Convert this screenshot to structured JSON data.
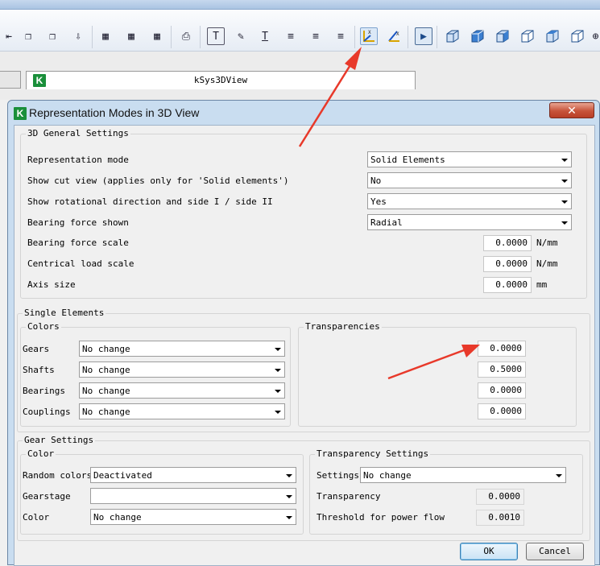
{
  "app": {
    "document_tab_title": "kSys3DView",
    "logo_letter": "K"
  },
  "toolbar": {
    "icons": [
      "merge-icon",
      "copy-icon",
      "paste-icon",
      "table-text-icon",
      "table-add-icon",
      "table-add-2-icon",
      "print-icon",
      "text-box-icon",
      "paint-icon",
      "text-underline-icon",
      "align-left-icon",
      "align-center-icon",
      "align-right-icon",
      "axis-zxy-icon",
      "axis-zxy-2-icon",
      "play-icon",
      "cube-icon",
      "cube-view-icon"
    ],
    "labels": {
      "text_icon": "T",
      "axis1": "ZXY",
      "play": "▶"
    }
  },
  "dialog": {
    "title": "Representation Modes in 3D View",
    "close_label": "✕",
    "general": {
      "legend": "3D General Settings",
      "representation_mode_label": "Representation mode",
      "representation_mode_value": "Solid Elements",
      "show_cut_label": "Show cut view (applies only for 'Solid elements')",
      "show_cut_value": "No",
      "rotational_label": "Show rotational direction and side I / side II",
      "rotational_value": "Yes",
      "bearing_force_label": "Bearing force shown",
      "bearing_force_value": "Radial",
      "bearing_scale_label": "Bearing force scale",
      "bearing_scale_value": "0.0000",
      "bearing_scale_unit": "N/mm",
      "central_load_label": "Centrical load scale",
      "central_load_value": "0.0000",
      "central_load_unit": "N/mm",
      "axis_size_label": "Axis size",
      "axis_size_value": "0.0000",
      "axis_size_unit": "mm"
    },
    "single": {
      "legend": "Single Elements",
      "colors_legend": "Colors",
      "transparencies_legend": "Transparencies",
      "rows": [
        {
          "label": "Gears",
          "color": "No change",
          "transparency": "0.0000"
        },
        {
          "label": "Shafts",
          "color": "No change",
          "transparency": "0.5000"
        },
        {
          "label": "Bearings",
          "color": "No change",
          "transparency": "0.0000"
        },
        {
          "label": "Couplings",
          "color": "No change",
          "transparency": "0.0000"
        }
      ]
    },
    "gear": {
      "legend": "Gear Settings",
      "color_legend": "Color",
      "random_colors_label": "Random colors",
      "random_colors_value": "Deactivated",
      "gearstage_label": "Gearstage",
      "gearstage_value": "",
      "color_label": "Color",
      "color_value": "No change",
      "transparency_legend": "Transparency Settings",
      "settings_label": "Settings",
      "settings_value": "No change",
      "transparency_label": "Transparency",
      "transparency_value": "0.0000",
      "threshold_label": "Threshold for power flow",
      "threshold_value": "0.0010"
    },
    "buttons": {
      "ok": "OK",
      "cancel": "Cancel"
    }
  },
  "colors": {
    "annotation_arrow": "#e8392a",
    "logo_green": "#1a8f3a"
  }
}
